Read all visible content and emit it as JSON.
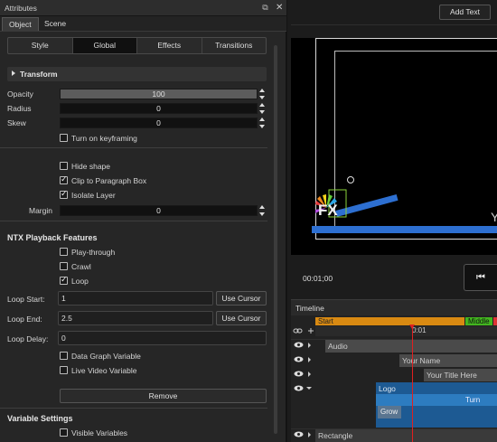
{
  "panel": {
    "title": "Attributes",
    "tabs": [
      "Object",
      "Scene"
    ],
    "active_tab": "Object"
  },
  "subtabs": [
    "Style",
    "Global",
    "Effects",
    "Transitions"
  ],
  "active_subtab": "Global",
  "transform": {
    "heading": "Transform",
    "opacity": {
      "label": "Opacity",
      "value": "100"
    },
    "radius": {
      "label": "Radius",
      "value": "0"
    },
    "skew": {
      "label": "Skew",
      "value": "0"
    },
    "keyframing": {
      "label": "Turn on keyframing",
      "checked": false
    }
  },
  "options": {
    "hide_shape": {
      "label": "Hide shape",
      "checked": false
    },
    "clip": {
      "label": "Clip to Paragraph Box",
      "checked": true
    },
    "isolate": {
      "label": "Isolate Layer",
      "checked": true
    },
    "margin": {
      "label": "Margin",
      "value": "0"
    }
  },
  "ntx": {
    "heading": "NTX Playback Features",
    "play_through": {
      "label": "Play-through",
      "checked": false
    },
    "crawl": {
      "label": "Crawl",
      "checked": false
    },
    "loop": {
      "label": "Loop",
      "checked": true
    },
    "loop_start": {
      "label": "Loop Start:",
      "value": "1",
      "button": "Use Cursor"
    },
    "loop_end": {
      "label": "Loop End:",
      "value": "2.5",
      "button": "Use Cursor"
    },
    "loop_delay": {
      "label": "Loop Delay:",
      "value": "0"
    },
    "data_graph": {
      "label": "Data Graph Variable",
      "checked": false
    },
    "live_video": {
      "label": "Live Video Variable",
      "checked": false
    },
    "remove_button": "Remove"
  },
  "variables": {
    "heading": "Variable Settings",
    "visible": {
      "label": "Visible Variables",
      "checked": false
    }
  },
  "viewer": {
    "add_text_button": "Add Text",
    "timecode": "00:01;00",
    "skip_icon": "⏮",
    "fx_text": "FX",
    "partial_text": "Y"
  },
  "timeline": {
    "title": "Timeline",
    "markers": [
      "Start",
      "Middle"
    ],
    "ruler_time": "0:01",
    "tracks": [
      "Audio",
      "Your Name",
      "Your Title Here",
      "Logo",
      "Rectangle"
    ],
    "logo_sub": "Turn",
    "logo_grow": "Grow"
  },
  "colors": {
    "accent_blue": "#2d6fd1",
    "marker_start": "#d98a12",
    "marker_middle": "#42b51f",
    "playhead": "#e02020"
  }
}
